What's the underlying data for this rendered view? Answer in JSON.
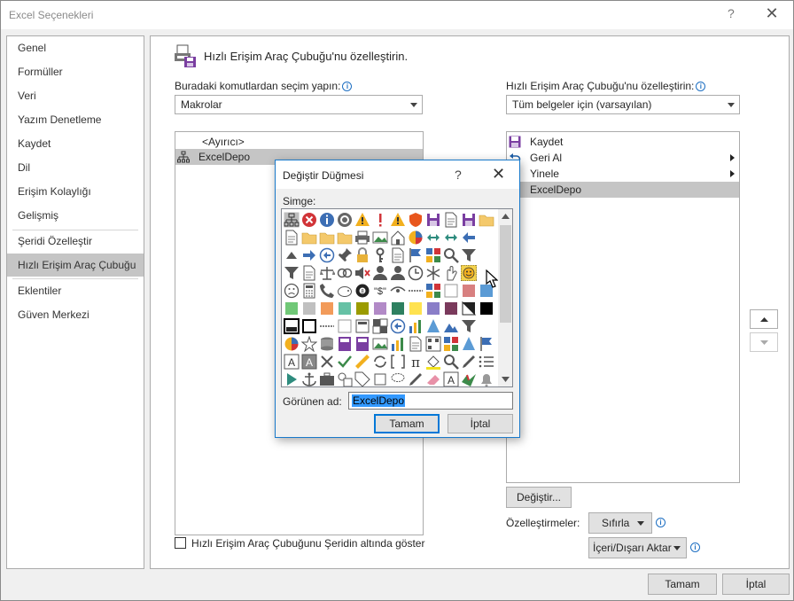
{
  "window": {
    "title": "Excel Seçenekleri",
    "help": "?",
    "close": "✕"
  },
  "nav": {
    "items": [
      {
        "label": "Genel",
        "selected": false
      },
      {
        "label": "Formüller",
        "selected": false
      },
      {
        "label": "Veri",
        "selected": false
      },
      {
        "label": "Yazım Denetleme",
        "selected": false
      },
      {
        "label": "Kaydet",
        "selected": false
      },
      {
        "label": "Dil",
        "selected": false
      },
      {
        "label": "Erişim Kolaylığı",
        "selected": false
      },
      {
        "label": "Gelişmiş",
        "selected": false
      },
      {
        "label": "Şeridi Özelleştir",
        "selected": false
      },
      {
        "label": "Hızlı Erişim Araç Çubuğu",
        "selected": true
      },
      {
        "label": "Eklentiler",
        "selected": false
      },
      {
        "label": "Güven Merkezi",
        "selected": false
      }
    ]
  },
  "main": {
    "title": "Hızlı Erişim Araç Çubuğu'nu özelleştirin.",
    "choose_label": "Buradaki komutlardan seçim yapın:",
    "choose_value": "Makrolar",
    "customize_label": "Hızlı Erişim Araç Çubuğu'nu özelleştirin:",
    "customize_value": "Tüm belgeler için (varsayılan)",
    "left_list": [
      "<Ayırıcı>",
      "ExcelDepo"
    ],
    "right_list": [
      {
        "label": "Kaydet",
        "icon": "save-icon",
        "arrow": false
      },
      {
        "label": "Geri Al",
        "icon": "undo-icon",
        "arrow": true
      },
      {
        "label": "Yinele",
        "icon": "redo-icon",
        "arrow": true
      },
      {
        "label": "ExcelDepo",
        "icon": "macro-smiley-icon",
        "arrow": false
      }
    ],
    "modify_button": "Değiştir...",
    "customizations_label": "Özelleştirmeler:",
    "reset_button": "Sıfırla",
    "import_export_button": "İçeri/Dışarı Aktar",
    "show_below_label": "Hızlı Erişim Araç Çubuğunu Şeridin altında göster"
  },
  "footer": {
    "ok": "Tamam",
    "cancel": "İptal"
  },
  "modify_dialog": {
    "title": "Değiştir Düğmesi",
    "help": "?",
    "close": "✕",
    "symbol_label": "Simge:",
    "display_name_label": "Görünen ad:",
    "display_name_value": "ExcelDepo",
    "ok": "Tamam",
    "cancel": "İptal"
  },
  "colors": {
    "selection": "#c5c5c5",
    "accent": "#0078d7",
    "text_highlight": "#3399ff"
  }
}
